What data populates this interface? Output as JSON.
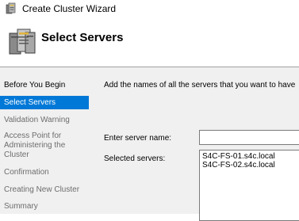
{
  "window": {
    "title": "Create Cluster Wizard"
  },
  "header": {
    "title": "Select Servers"
  },
  "sidebar": {
    "items": [
      {
        "label": "Before You Begin",
        "state": "done"
      },
      {
        "label": "Select Servers",
        "state": "active"
      },
      {
        "label": "Validation Warning",
        "state": "pending"
      },
      {
        "label": "Access Point for Administering the Cluster",
        "state": "pending"
      },
      {
        "label": "Confirmation",
        "state": "pending"
      },
      {
        "label": "Creating New Cluster",
        "state": "pending"
      },
      {
        "label": "Summary",
        "state": "pending"
      }
    ]
  },
  "main": {
    "instruction": "Add the names of all the servers that you want to have",
    "server_name_label": "Enter server name:",
    "server_name_value": "",
    "selected_servers_label": "Selected servers:",
    "selected_servers": [
      "S4C-FS-01.s4c.local",
      "S4C-FS-02.s4c.local"
    ]
  },
  "colors": {
    "selection": "#0078d7",
    "panel": "#f0f0f0",
    "disabled_text": "#6d6d6d"
  },
  "icons": {
    "title": "cluster-wizard-icon",
    "header": "server-cluster-icon"
  }
}
